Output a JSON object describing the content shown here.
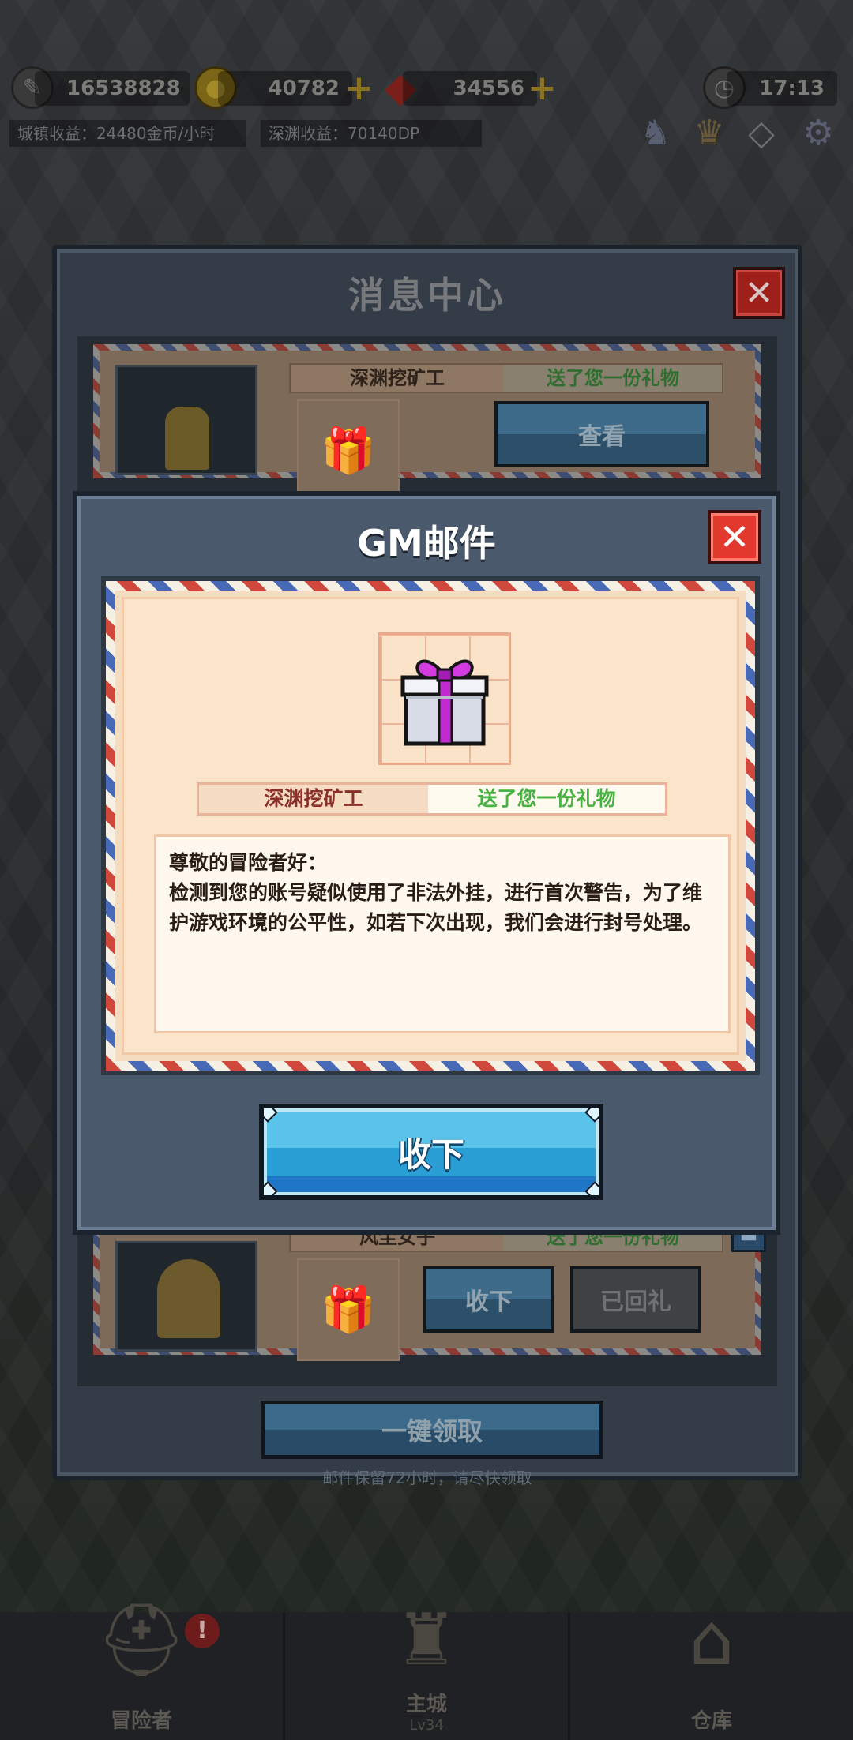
{
  "hud": {
    "power_value": "16538828",
    "gold_value": "40782",
    "gem_value": "34556",
    "clock_time": "17:13",
    "town_income": "城镇收益：24480金币/小时",
    "abyss_income": "深渊收益：70140DP"
  },
  "message_center": {
    "title": "消息中心",
    "close_glyph": "✕",
    "mail_top": {
      "sender": "深渊挖矿工",
      "message": "送了您一份礼物",
      "view_label": "查看"
    },
    "mail_bottom": {
      "sender": "风尘女子",
      "message": "送了您一份礼物",
      "accept_label": "收下",
      "reply_label": "已回礼"
    },
    "claim_all_label": "一键领取",
    "keep_note": "邮件保留72小时，请尽快领取"
  },
  "gm_dialog": {
    "title": "GM邮件",
    "close_glyph": "✕",
    "sender": "深渊挖矿工",
    "message": "送了您一份礼物",
    "body": "尊敬的冒险者好：\n检测到您的账号疑似使用了非法外挂，进行首次警告，为了维护游戏环境的公平性，如若下次出现，我们会进行封号处理。",
    "accept_label": "收下"
  },
  "bottom_nav": {
    "items": [
      {
        "label": "冒险者"
      },
      {
        "label": "主城",
        "sub": "Lv34"
      },
      {
        "label": "仓库"
      }
    ],
    "alert_glyph": "!"
  },
  "colors": {
    "dialog_bg": "#4b596c",
    "accept_blue": "#2a9fd6",
    "close_red": "#e2382e",
    "gift_text_green": "#48b343"
  }
}
